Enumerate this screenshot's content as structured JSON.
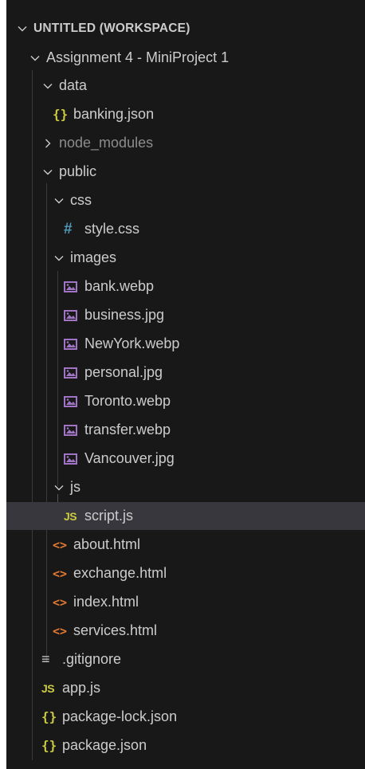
{
  "explorer": {
    "workspace_label": "UNTITLED (WORKSPACE)",
    "project_label": "Assignment 4 - MiniProject 1",
    "data_folder": "data",
    "banking_json": "banking.json",
    "node_modules": "node_modules",
    "public_folder": "public",
    "css_folder": "css",
    "style_css": "style.css",
    "images_folder": "images",
    "images": [
      "bank.webp",
      "business.jpg",
      "NewYork.webp",
      "personal.jpg",
      "Toronto.webp",
      "transfer.webp",
      "Vancouver.jpg"
    ],
    "js_folder": "js",
    "script_js": "script.js",
    "html_files": [
      "about.html",
      "exchange.html",
      "index.html",
      "services.html"
    ],
    "gitignore": ".gitignore",
    "app_js": "app.js",
    "package_lock": "package-lock.json",
    "package_json": "package.json"
  },
  "icons": {
    "json_glyph": "{}",
    "css_glyph": "#",
    "js_glyph": "JS",
    "html_glyph": "<>",
    "gitignore_glyph": "≡"
  },
  "colors": {
    "background": "#181818",
    "selected_row": "#37373d",
    "text": "#cccccc",
    "dim_text": "#8c8c8c",
    "json_icon": "#cbcb41",
    "css_icon": "#519aba",
    "html_icon": "#e37933",
    "image_icon": "#a074c4"
  }
}
